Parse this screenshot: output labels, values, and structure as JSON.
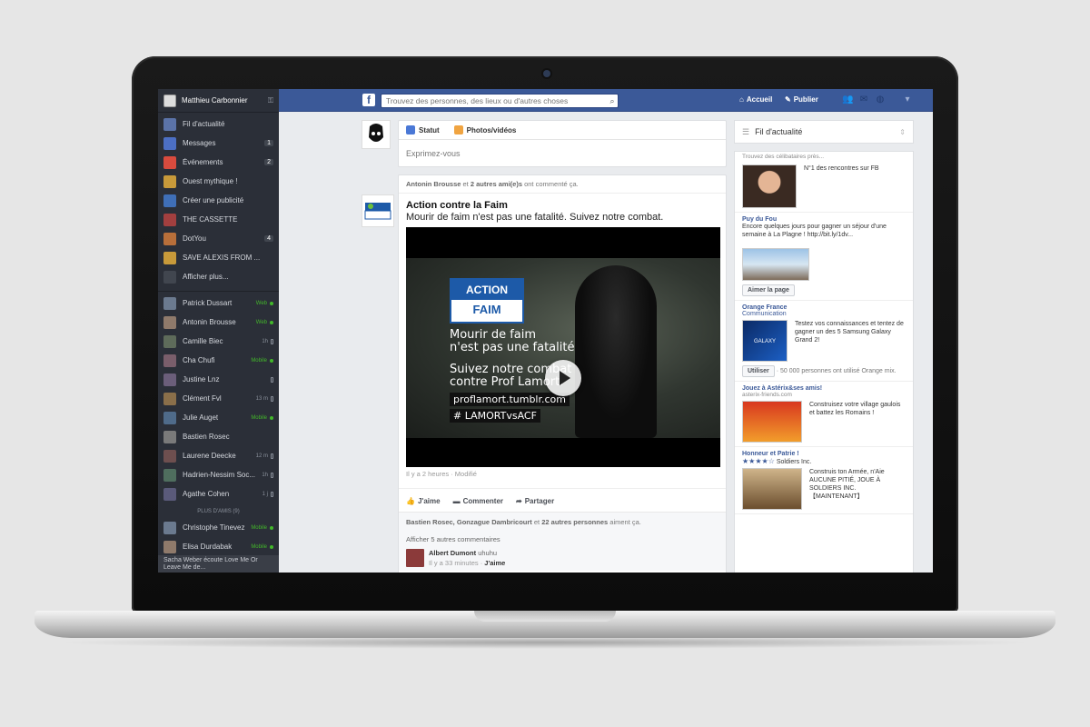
{
  "sidebar": {
    "user_name": "Matthieu Carbonnier",
    "nav": [
      {
        "label": "Fil d'actualité",
        "icon": "news-feed-icon",
        "color": "#5b73a8",
        "badge": ""
      },
      {
        "label": "Messages",
        "icon": "messages-icon",
        "color": "#4c6fc4",
        "badge": "1"
      },
      {
        "label": "Événements",
        "icon": "calendar-icon",
        "color": "#d84b3e",
        "badge": "2"
      },
      {
        "label": "Ouest mythique !",
        "icon": "group-icon",
        "color": "#c89a3a",
        "badge": ""
      },
      {
        "label": "Créer une publicité",
        "icon": "ads-icon",
        "color": "#3f6fb8",
        "badge": ""
      },
      {
        "label": "THE CASSETTE",
        "icon": "group-icon",
        "color": "#a23f3f",
        "badge": ""
      },
      {
        "label": "DotYou",
        "icon": "group-icon",
        "color": "#b86f3a",
        "badge": "4"
      },
      {
        "label": "SAVE ALEXIS FROM ...",
        "icon": "group-icon",
        "color": "#c89a3a",
        "badge": ""
      },
      {
        "label": "Afficher plus...",
        "icon": "chevron-down-icon",
        "color": "#41464f",
        "badge": ""
      }
    ],
    "chats": [
      {
        "name": "Patrick Dussart",
        "status": "Web",
        "type": "web"
      },
      {
        "name": "Antonin Brousse",
        "status": "Web",
        "type": "web"
      },
      {
        "name": "Camille Biec",
        "status": "1h",
        "type": "mobile"
      },
      {
        "name": "Cha Chufi",
        "status": "Mobile",
        "type": "web"
      },
      {
        "name": "Justine Lnz",
        "status": "",
        "type": "mobile"
      },
      {
        "name": "Clément Fvl",
        "status": "13 m",
        "type": "mobile"
      },
      {
        "name": "Julie Auget",
        "status": "Mobile",
        "type": "web"
      },
      {
        "name": "Bastien Rosec",
        "status": "",
        "type": "none"
      },
      {
        "name": "Laurene Deecke",
        "status": "12 m",
        "type": "mobile"
      },
      {
        "name": "Hadrien-Nessim Soc...",
        "status": "1h",
        "type": "mobile"
      },
      {
        "name": "Agathe Cohen",
        "status": "1 j",
        "type": "mobile"
      }
    ],
    "more_friends": "PLUS D'AMIS (9)",
    "chats2": [
      {
        "name": "Christophe Tinevez",
        "status": "Mobile",
        "type": "web"
      },
      {
        "name": "Elisa Durdabak",
        "status": "Mobile",
        "type": "web"
      }
    ],
    "footer": "Sacha Weber écoute Love Me Or Leave Me de..."
  },
  "topbar": {
    "search_placeholder": "Trouvez des personnes, des lieux ou d'autres choses",
    "home": "Accueil",
    "publish": "Publier"
  },
  "composer": {
    "tab_status": "Statut",
    "tab_photos": "Photos/vidéos",
    "placeholder": "Exprimez-vous"
  },
  "post": {
    "header_names": "Antonin Brousse",
    "header_mid": "et",
    "header_friends": "2 autres ami(e)s",
    "header_tail": "ont commenté ça.",
    "page_name": "Action contre la Faim",
    "text": "Mourir de faim n'est pas une fatalité. Suivez notre combat.",
    "video": {
      "logo_top": "ACTION",
      "logo_bottom": "FAIM",
      "line1": "Mourir de faim",
      "line2": "n'est pas une fatalité",
      "line3": "Suivez notre combat",
      "line4": "contre Prof Lamort.",
      "url": "proflamort.tumblr.com",
      "hashtag": "# LAMORTvsACF"
    },
    "time": "Il y a 2 heures · Modifié",
    "like": "J'aime",
    "comment": "Commenter",
    "share": "Partager",
    "likes_names": "Bastien Rosec, Gonzague Dambricourt",
    "likes_mid": "et",
    "likes_count": "22 autres personnes",
    "likes_tail": "aiment ça.",
    "show_comments": "Afficher 5 autres commentaires",
    "comment1_author": "Albert Dumont",
    "comment1_text": "uhuhu",
    "comment1_time": "Il y a 33 minutes ·",
    "comment1_like": "J'aime"
  },
  "right": {
    "feed_label": "Fil d'actualité",
    "ads_caption": "Trouvez des célibataires près...",
    "ad1_text": "N°1 des rencontres sur FB",
    "ad2_title": "Puy du Fou",
    "ad2_text": "Encore quelques jours pour gagner un séjour d'une semaine à La Plagne ! http://bit.ly/1dv...",
    "ad2_button": "Aimer la page",
    "ad3_title": "Orange France",
    "ad3_sub": "Communication",
    "ad3_text": "Testez vos connaissances et tentez de gagner un des 5 Samsung Galaxy Grand 2!",
    "ad3_button": "Utiliser",
    "ad3_users": "· 50 000 personnes ont utilisé Orange mix.",
    "ad4_title": "Jouez à Astérix&ses amis!",
    "ad4_url": "asterix-friends.com",
    "ad4_text": "Construisez votre village gaulois et battez les Romains !",
    "ad5_title": "Honneur et Patrie !",
    "ad5_sub": "Soldiers Inc.",
    "ad5_text": "Construis ton Armée, n'Aie AUCUNE PITIÉ, JOUE À SOLDIERS INC. 【MAINTENANT】"
  }
}
